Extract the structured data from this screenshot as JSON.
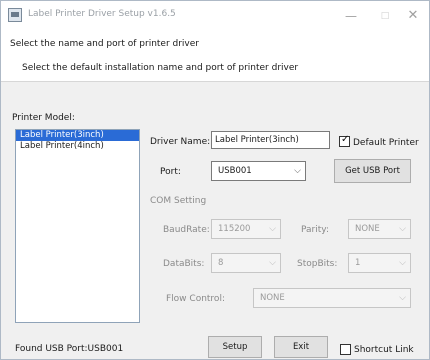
{
  "window": {
    "title": "Label Printer Driver Setup v1.6.5",
    "minimize_glyph": "—",
    "maximize_glyph": "□",
    "close_glyph": "✕"
  },
  "header": {
    "title": "Select the name and port of printer driver",
    "subtitle": "Select the default installation name and port of printer driver"
  },
  "printer_model": {
    "label": "Printer Model:",
    "items": [
      {
        "label": "Label Printer(3inch)",
        "selected": true
      },
      {
        "label": "Label Printer(4inch)",
        "selected": false
      }
    ]
  },
  "driver": {
    "name_label": "Driver Name:",
    "name_value": "Label Printer(3inch)",
    "default_label": "Default Printer",
    "default_checked": true
  },
  "port": {
    "label": "Port:",
    "value": "USB001",
    "get_button": "Get USB Port"
  },
  "com": {
    "heading": "COM Setting",
    "baud_label": "BaudRate:",
    "baud_value": "115200",
    "parity_label": "Parity:",
    "parity_value": "NONE",
    "databits_label": "DataBits:",
    "databits_value": "8",
    "stopbits_label": "StopBits:",
    "stopbits_value": "1",
    "flow_label": "Flow Control:",
    "flow_value": "NONE"
  },
  "footer": {
    "status": "Found USB Port:USB001",
    "setup_button": "Setup",
    "exit_button": "Exit",
    "shortcut_label": "Shortcut Link",
    "shortcut_checked": false
  },
  "icons": {
    "chevron": "chevron-down-icon"
  }
}
